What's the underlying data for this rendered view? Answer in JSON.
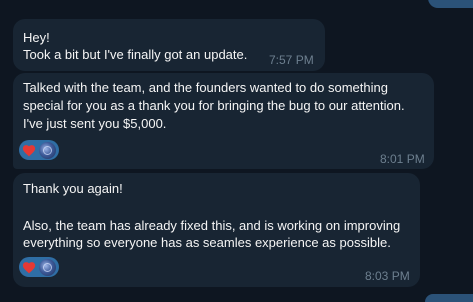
{
  "messages": [
    {
      "lines": [
        "Hey!",
        "Took a bit but I've finally got an update."
      ],
      "time": "7:57 PM"
    },
    {
      "lines": [
        "Talked with the team, and the founders wanted to do something",
        "special for you as a thank you for  bringing the bug to our attention.",
        "I've just sent you $5,000."
      ],
      "time": "8:01 PM",
      "reactions": [
        "heart-icon",
        "avatar"
      ]
    },
    {
      "lines": [
        "Thank you again!",
        "",
        "Also, the team has already fixed this, and is working on improving",
        "everything so everyone has as seamles experience as possible."
      ],
      "time": "8:03 PM",
      "reactions": [
        "heart-icon",
        "avatar"
      ]
    }
  ],
  "colors": {
    "background": "#0e1621",
    "bubble_incoming": "#182533",
    "bubble_outgoing": "#2b5278",
    "reaction_pill": "#2f6ea5",
    "heart": "#e53935",
    "timestamp": "#6d7f8f"
  }
}
